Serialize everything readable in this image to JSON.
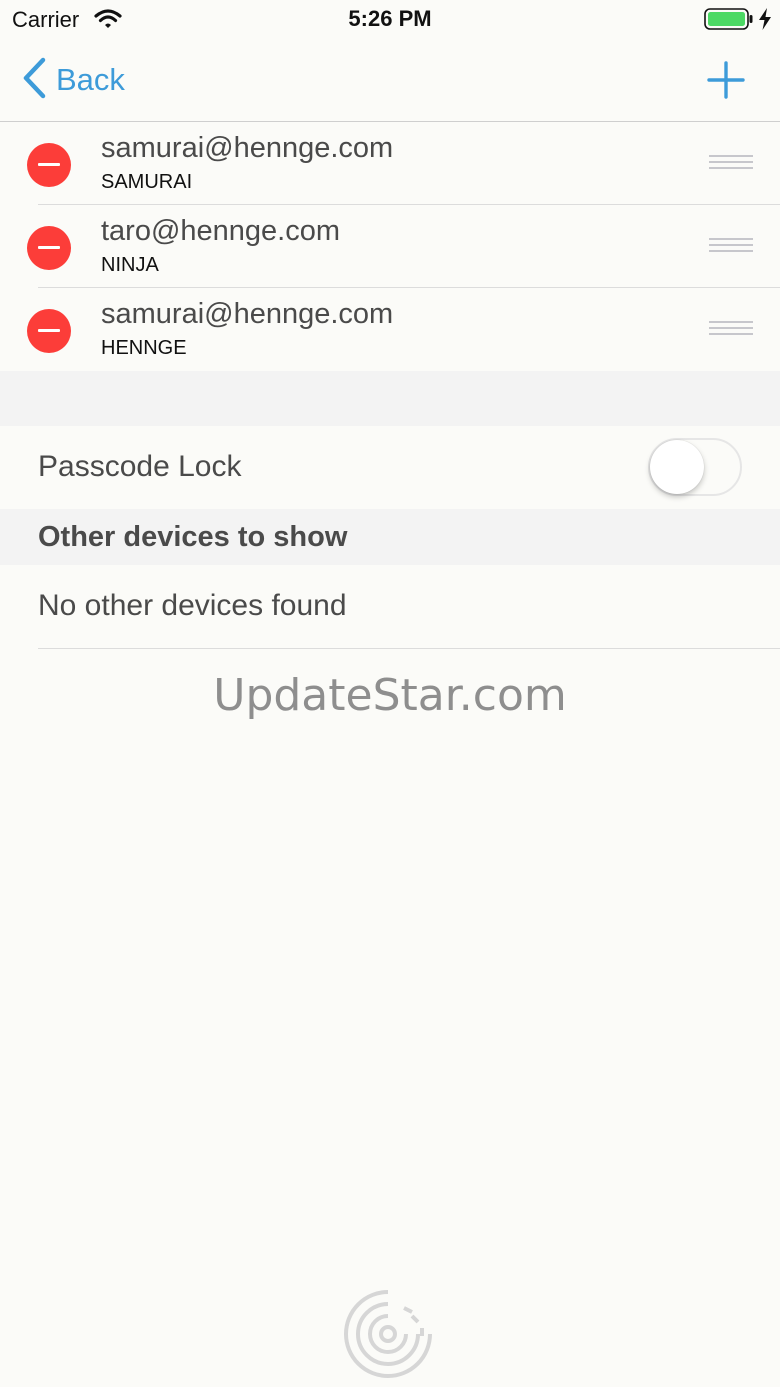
{
  "status_bar": {
    "carrier": "Carrier",
    "time": "5:26 PM",
    "icons": [
      "wifi-icon",
      "battery-icon",
      "charging-icon"
    ],
    "battery_color": "#4cd964"
  },
  "nav": {
    "back_label": "Back",
    "add_icon": "plus-icon",
    "accent_color": "#3d9bd9"
  },
  "accounts": [
    {
      "email": "samurai@hennge.com",
      "name": "SAMURAI"
    },
    {
      "email": "taro@hennge.com",
      "name": "NINJA"
    },
    {
      "email": "samurai@hennge.com",
      "name": "HENNGE"
    }
  ],
  "delete_color": "#fc3d39",
  "passcode": {
    "label": "Passcode Lock",
    "enabled": false
  },
  "other_devices": {
    "header": "Other devices to show",
    "empty_text": "No other devices found"
  },
  "watermark": {
    "text": "UpdateStar.com"
  }
}
